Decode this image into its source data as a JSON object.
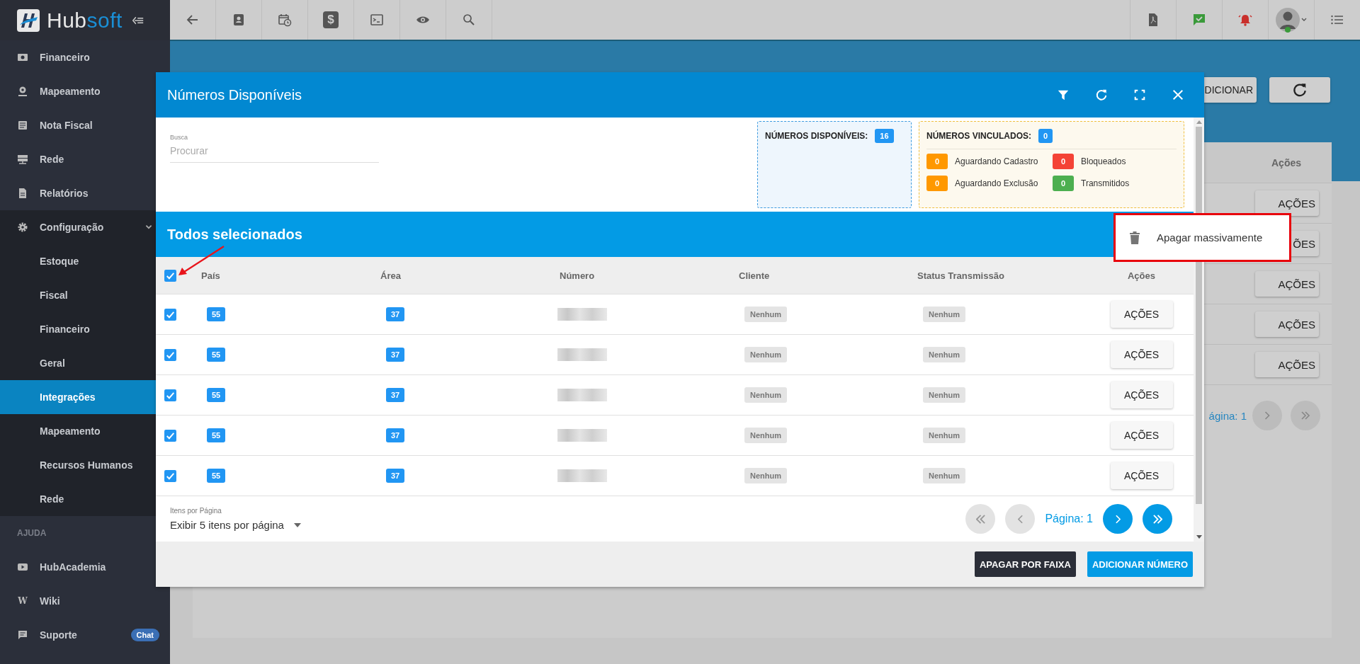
{
  "sidebar": {
    "brand": {
      "main": "Hub",
      "accent": "soft"
    },
    "items": [
      {
        "label": "Financeiro",
        "kind": "money",
        "selected": false
      },
      {
        "label": "Mapeamento",
        "kind": "pin",
        "selected": false
      },
      {
        "label": "Nota Fiscal",
        "kind": "invoice",
        "selected": false
      },
      {
        "label": "Rede",
        "kind": "network",
        "selected": false
      },
      {
        "label": "Relatórios",
        "kind": "report",
        "selected": false
      },
      {
        "label": "Configuração",
        "kind": "settings",
        "selected": false,
        "expanded": true,
        "children": [
          {
            "label": "Estoque",
            "selected": false
          },
          {
            "label": "Fiscal",
            "selected": false
          },
          {
            "label": "Financeiro",
            "selected": false
          },
          {
            "label": "Geral",
            "selected": false
          },
          {
            "label": "Integrações",
            "selected": true
          },
          {
            "label": "Mapeamento",
            "selected": false
          },
          {
            "label": "Recursos Humanos",
            "selected": false
          },
          {
            "label": "Rede",
            "selected": false
          }
        ]
      }
    ],
    "help_title": "AJUDA",
    "help_items": [
      {
        "label": "HubAcademia",
        "kind": "video"
      },
      {
        "label": "Wiki",
        "kind": "glyph",
        "glyph": "W"
      },
      {
        "label": "Suporte",
        "kind": "chat",
        "badge": "Chat"
      }
    ]
  },
  "topbar": {
    "left": [
      {
        "kind": "back"
      },
      {
        "kind": "contact"
      },
      {
        "kind": "calendar"
      },
      {
        "kind": "money",
        "glyph": "$"
      },
      {
        "kind": "terminal"
      },
      {
        "kind": "view"
      },
      {
        "kind": "search"
      }
    ],
    "right": [
      {
        "kind": "pdf"
      },
      {
        "kind": "message"
      },
      {
        "kind": "bell"
      },
      {
        "kind": "avatar"
      },
      {
        "kind": "list"
      }
    ]
  },
  "background_page": {
    "add_button": "DICIONAR",
    "column": "Ações",
    "row_buttons": [
      "AÇÕES",
      "ÕES",
      "AÇÕES",
      "AÇÕES",
      "AÇÕES"
    ],
    "page_label": "ágina: 1"
  },
  "modal": {
    "title": "Números Disponíveis",
    "search": {
      "label": "Busca",
      "placeholder": "Procurar"
    },
    "available": {
      "label": "NÚMEROS DISPONÍVEIS:",
      "count": "16"
    },
    "linked": {
      "label": "NÚMEROS VINCULADOS:",
      "count": "0",
      "statuses": [
        {
          "label": "Aguardando Cadastro",
          "count": "0",
          "color": "#ff9800"
        },
        {
          "label": "Bloqueados",
          "count": "0",
          "color": "#f44336"
        },
        {
          "label": "Aguardando Exclusão",
          "count": "0",
          "color": "#ff9800"
        },
        {
          "label": "Transmitidos",
          "count": "0",
          "color": "#4caf50"
        }
      ]
    },
    "banner": "Todos selecionados",
    "table": {
      "all_checked": true,
      "columns": [
        "País",
        "Área",
        "Número",
        "Cliente",
        "Status Transmissão",
        "Ações"
      ],
      "rows": [
        {
          "checked": true,
          "country": "55",
          "area": "37",
          "client": "Nenhum",
          "transmission": "Nenhum",
          "action": "AÇÕES"
        },
        {
          "checked": true,
          "country": "55",
          "area": "37",
          "client": "Nenhum",
          "transmission": "Nenhum",
          "action": "AÇÕES"
        },
        {
          "checked": true,
          "country": "55",
          "area": "37",
          "client": "Nenhum",
          "transmission": "Nenhum",
          "action": "AÇÕES"
        },
        {
          "checked": true,
          "country": "55",
          "area": "37",
          "client": "Nenhum",
          "transmission": "Nenhum",
          "action": "AÇÕES"
        },
        {
          "checked": true,
          "country": "55",
          "area": "37",
          "client": "Nenhum",
          "transmission": "Nenhum",
          "action": "AÇÕES"
        }
      ]
    },
    "per_page": {
      "label": "Itens por Página",
      "value": "Exibir 5 itens por página"
    },
    "pagination": {
      "label": "Página: 1",
      "buttons": [
        {
          "kind": "first",
          "disabled": true
        },
        {
          "kind": "prev",
          "disabled": true
        },
        {
          "kind": "next",
          "disabled": false
        },
        {
          "kind": "last",
          "disabled": false
        }
      ]
    },
    "footer_buttons": [
      {
        "label": "APAGAR POR FAIXA",
        "kind": "dark"
      },
      {
        "label": "ADICIONAR NÚMERO",
        "kind": "primary"
      }
    ]
  },
  "context_menu": {
    "items": [
      {
        "label": "Apagar massivamente"
      }
    ]
  }
}
